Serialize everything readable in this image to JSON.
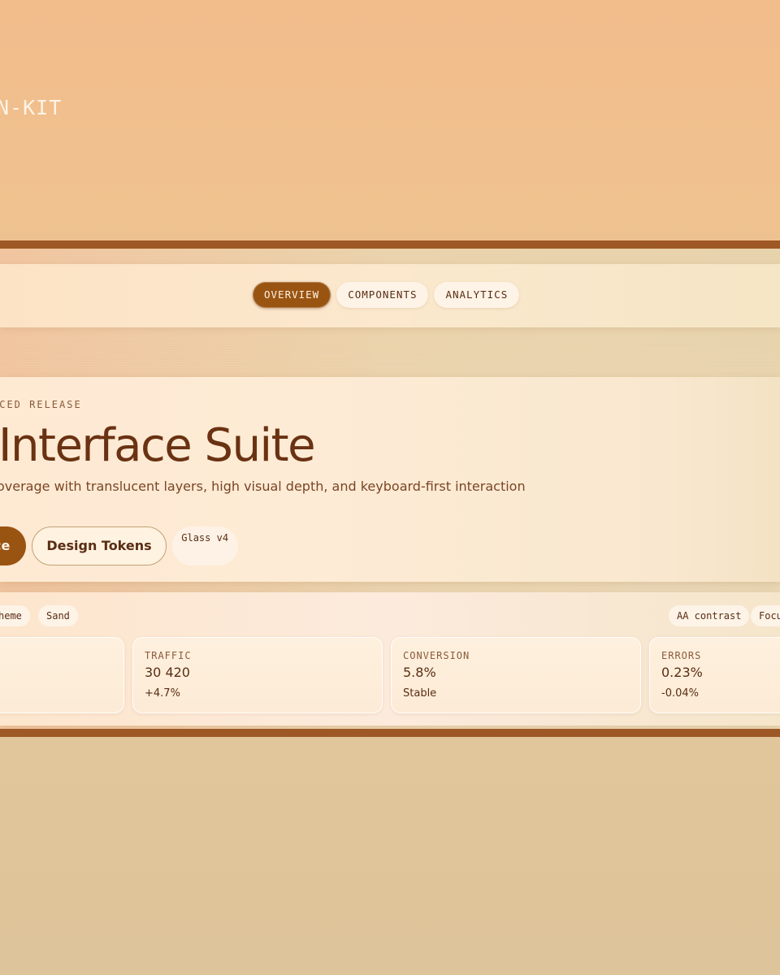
{
  "brand": {
    "name": "N-KIT"
  },
  "nav": {
    "tabs": [
      {
        "label": "OVERVIEW",
        "active": true
      },
      {
        "label": "COMPONENTS",
        "active": false
      },
      {
        "label": "ANALYTICS",
        "active": false
      }
    ]
  },
  "hero": {
    "eyebrow": "NCED RELEASE",
    "title": "Interface Suite",
    "subtitle": "overage with translucent layers, high visual depth, and keyboard-first interaction",
    "primary_cta": "ce",
    "secondary_cta": "Design Tokens",
    "version_chip": "Glass v4"
  },
  "filters": {
    "left_chips": [
      "heme",
      "Sand"
    ],
    "right_chips": [
      "AA contrast",
      "Focu"
    ]
  },
  "metrics": [
    {
      "label": "TRAFFIC",
      "value": "30 420",
      "delta": "+4.7%"
    },
    {
      "label": "CONVERSION",
      "value": "5.8%",
      "delta": "Stable"
    },
    {
      "label": "ERRORS",
      "value": "0.23%",
      "delta": "-0.04%"
    }
  ],
  "colors": {
    "accent": "#9a5412",
    "bar": "#9e5825",
    "text": "#6a3212",
    "background_top": "#f2bc8b",
    "background_bottom": "#dec49a"
  }
}
